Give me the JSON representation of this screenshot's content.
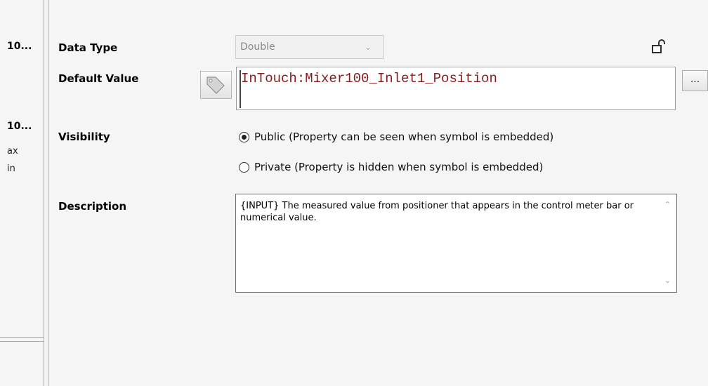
{
  "left_panel": {
    "item1": "10...",
    "item2": "10...",
    "item3": "ax",
    "item4": "in"
  },
  "fields": {
    "data_type_label": "Data Type",
    "data_type_value": "Double",
    "default_value_label": "Default Value",
    "default_value": "InTouch:Mixer100_Inlet1_Position",
    "browse_label": "...",
    "visibility_label": "Visibility",
    "visibility_public": "Public (Property can be seen when symbol is embedded)",
    "visibility_private": "Private (Property is hidden when symbol is embedded)",
    "description_label": "Description",
    "description_value": "{INPUT} The measured value from positioner that appears in the control meter bar or numerical value."
  },
  "icons": {
    "lock": "unlock-icon",
    "tag": "tag-icon",
    "scroll_up": "chevron-up-icon",
    "scroll_down": "chevron-down-icon",
    "dropdown": "chevron-down-icon"
  },
  "colors": {
    "default_value_text": "#8b1a1a",
    "lock_icon": "#2e2e2e"
  }
}
